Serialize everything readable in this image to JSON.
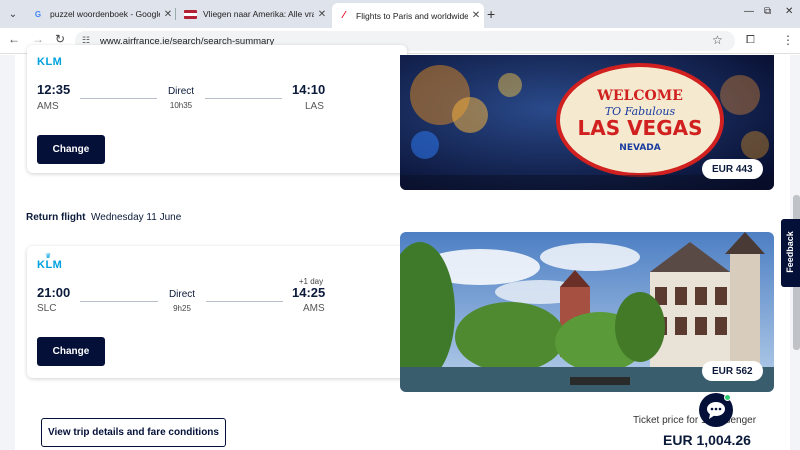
{
  "browser": {
    "tabs": [
      {
        "title": "puzzel woordenboek - Google Z",
        "icon": "google-icon"
      },
      {
        "title": "Vliegen naar Amerika: Alle vrag",
        "icon": "us-flag-icon"
      },
      {
        "title": "Flights to Paris and worldwide",
        "icon": "airfrance-icon"
      }
    ],
    "url": "www.airfrance.ie/search/search-summary"
  },
  "outbound": {
    "airline": "KLM",
    "dep_time": "12:35",
    "dep_code": "AMS",
    "type": "Direct",
    "duration": "10h35",
    "arr_time": "14:10",
    "arr_code": "LAS",
    "change_label": "Change",
    "price": "EUR 443",
    "image": "las-vegas-sign"
  },
  "return_header": {
    "label": "Return flight",
    "date": "Wednesday 11 June"
  },
  "return": {
    "airline": "KLM",
    "dep_time": "21:00",
    "dep_code": "SLC",
    "type": "Direct",
    "duration": "9h25",
    "day_offset": "+1 day",
    "arr_time": "14:25",
    "arr_code": "AMS",
    "change_label": "Change",
    "price": "EUR 562",
    "image": "amsterdam-canal"
  },
  "footer": {
    "view_details": "View trip details and fare conditions",
    "ticket_price_label": "Ticket price for 1 passenger",
    "total": "EUR 1,004.26"
  },
  "feedback_label": "Feedback",
  "colors": {
    "brand": "#051039",
    "klm": "#00a1de"
  }
}
